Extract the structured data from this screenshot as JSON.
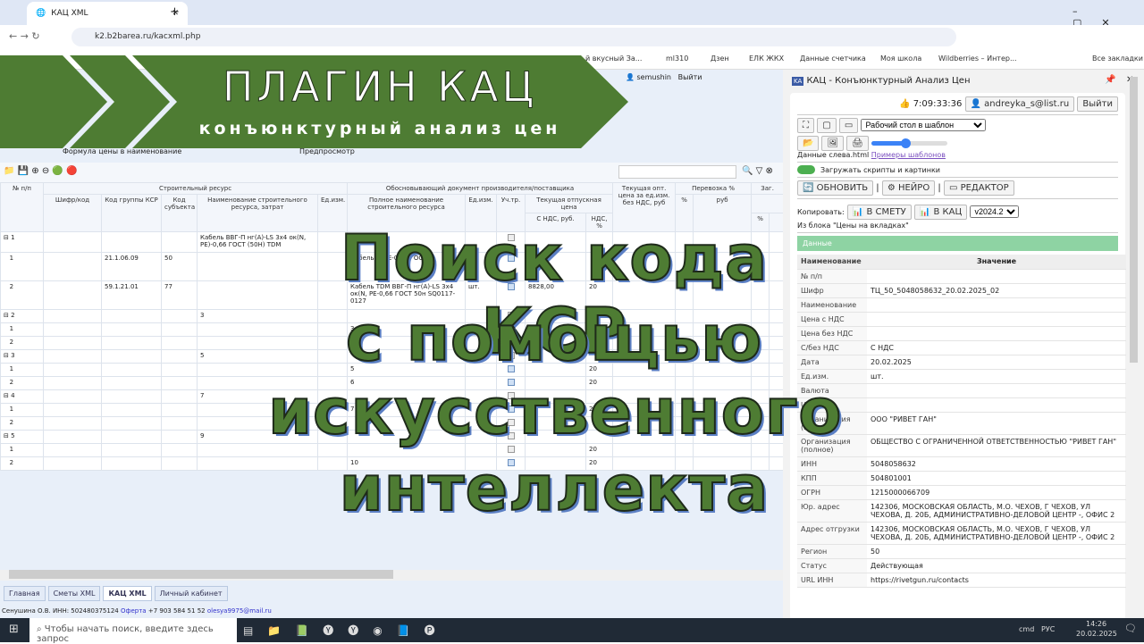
{
  "browser": {
    "tab_title": "КАЦ XML",
    "url": "k2.b2barea.ru/kacxml.php",
    "bookmarks": [
      "й вкусный За...",
      "ml310",
      "Дзен",
      "ЕЛК ЖКХ",
      "Данные счетчика",
      "Моя школа",
      "Wildberries – Интер...",
      "Все закладки"
    ]
  },
  "banner": {
    "title": "ПЛАГИН КАЦ",
    "subtitle": "конъюнктурный анализ цен"
  },
  "overlay": {
    "lines": [
      "Поиск кода КСР",
      "с помощью",
      "искусственного",
      "интеллекта"
    ]
  },
  "app": {
    "user": "semushin",
    "logout": "Выйти",
    "toolbar_items": [
      "Формула цены в наименование",
      "Предпросмотр"
    ],
    "headers": {
      "num": "№ п/п",
      "res": "Строительный ресурс",
      "doc": "Обосновывающий документ производителя/поставщика",
      "opt": "Текущая опт. цена за ед.изм. без НДС, руб",
      "trans": "Перевозка %",
      "zag": "Заг.",
      "code": "Шифр/код",
      "ksr": "Код группы КСР",
      "subj": "Код субъекта",
      "name": "Наименование строительного ресурса, затрат",
      "unit": "Ед.изм.",
      "full": "Полное наименование строительного ресурса",
      "unit2": "Ед.изм.",
      "uch": "Уч.тр.",
      "price": "Текущая отпускная цена",
      "vat": "С НДС, руб.",
      "vatp": "НДС, %",
      "pct": "%",
      "rub": "руб",
      "pct2": "%"
    },
    "rows": [
      {
        "num": "1",
        "group": true,
        "name": "Кабель ВВГ-П нг(А)-LS 3х4 ок(N, PE)-0,66 ГОСТ (50Н) TDM",
        "chk": false
      },
      {
        "num": "1",
        "ksr": "21.1.06.09",
        "subj": "50",
        "full": "Кабель ... PE-0,66 ГОСТ",
        "chk": true
      },
      {
        "num": "2",
        "ksr": "59.1.21.01",
        "subj": "77",
        "full": "Кабель TDM ВВГ-П нг(А)-LS 3х4 ок(N, PE-0,66 ГОСТ 50н SQ0117-0127",
        "unit2": "шт.",
        "chk": true,
        "price": "8828,00",
        "vatp": "20"
      },
      {
        "num": "2",
        "group": true,
        "name": "3",
        "chk": false
      },
      {
        "num": "1",
        "full": "3",
        "chk": true,
        "vatp": "20"
      },
      {
        "num": "2",
        "full": "4",
        "chk": false
      },
      {
        "num": "3",
        "group": true,
        "name": "5",
        "chk": false
      },
      {
        "num": "1",
        "full": "5",
        "chk": true,
        "vatp": "20"
      },
      {
        "num": "2",
        "full": "6",
        "chk": true,
        "vatp": "20"
      },
      {
        "num": "4",
        "group": true,
        "name": "7",
        "chk": false
      },
      {
        "num": "1",
        "full": "7",
        "chk": true,
        "vatp": "20"
      },
      {
        "num": "2",
        "full": "",
        "chk": false
      },
      {
        "num": "5",
        "group": true,
        "name": "9",
        "chk": false
      },
      {
        "num": "1",
        "full": "",
        "chk": false,
        "vatp": "20"
      },
      {
        "num": "2",
        "full": "10",
        "chk": true,
        "vatp": "20"
      }
    ],
    "bottom_tabs": [
      "Главная",
      "Сметы XML",
      "КАЦ XML",
      "Личный кабинет"
    ],
    "footer": {
      "text": "Сенушина О.В. ИНН: 502480375124",
      "oferta": "Оферта",
      "phone": "+7 903 584 51 52",
      "email": "olesya9975@mail.ru"
    }
  },
  "panel": {
    "title": "КАЦ - Конъюнктурный Анализ Цен",
    "timer": "7:09:33:36",
    "user": "andreyka_s@list.ru",
    "logout": "Выйти",
    "template_select": "Рабочий стол в шаблон",
    "slider_value": 45,
    "data_file": "Данные слева.html",
    "examples_link": "Примеры шаблонов",
    "toggle_label": "Загружать скрипты и картинки",
    "toggle_on": true,
    "refresh": "ОБНОВИТЬ",
    "neuro": "НЕЙРО",
    "editor": "РЕДАКТОР",
    "copy_label": "Копировать:",
    "to_smeta": "В СМЕТУ",
    "to_kac": "В КАЦ",
    "version": "v2024.2",
    "from_block": "Из блока \"Цены на вкладках\"",
    "section": "Данные",
    "col_name": "Наименование",
    "col_value": "Значение",
    "fields": [
      [
        "№ п/п",
        ""
      ],
      [
        "Шифр",
        "ТЦ_50_5048058632_20.02.2025_02"
      ],
      [
        "Наименование",
        ""
      ],
      [
        "Цена с НДС",
        ""
      ],
      [
        "Цена без НДС",
        ""
      ],
      [
        "С/без НДС",
        "С НДС"
      ],
      [
        "Дата",
        "20.02.2025"
      ],
      [
        "Ед.изм.",
        "шт."
      ],
      [
        "Валюта",
        ""
      ],
      [
        "URL",
        ""
      ],
      [
        "Организация (кратко)",
        "ООО \"РИВЕТ ГАН\""
      ],
      [
        "Организация (полное)",
        "ОБЩЕСТВО С ОГРАНИЧЕННОЙ ОТВЕТСТВЕННОСТЬЮ \"РИВЕТ ГАН\""
      ],
      [
        "ИНН",
        "5048058632"
      ],
      [
        "КПП",
        "504801001"
      ],
      [
        "ОГРН",
        "1215000066709"
      ],
      [
        "Юр. адрес",
        "142306, МОСКОВСКАЯ ОБЛАСТЬ, М.О. ЧЕХОВ, Г ЧЕХОВ, УЛ ЧЕХОВА, Д. 20Б, АДМИНИСТРАТИВНО-ДЕЛОВОЙ ЦЕНТР -, ОФИС 2"
      ],
      [
        "Адрес отгрузки",
        "142306, МОСКОВСКАЯ ОБЛАСТЬ, М.О. ЧЕХОВ, Г ЧЕХОВ, УЛ ЧЕХОВА, Д. 20Б, АДМИНИСТРАТИВНО-ДЕЛОВОЙ ЦЕНТР -, ОФИС 2"
      ],
      [
        "Регион",
        "50"
      ],
      [
        "Статус",
        "Действующая"
      ],
      [
        "URL ИНН",
        "https://rivetgun.ru/contacts"
      ]
    ]
  },
  "taskbar": {
    "search_placeholder": "Чтобы начать поиск, введите здесь запрос",
    "cmd": "cmd",
    "lang": "РУС",
    "time": "14:26",
    "date": "20.02.2025"
  },
  "colors": {
    "banner": "#4e7c33",
    "section": "#8ed3a3",
    "accent": "#3b82f6"
  }
}
